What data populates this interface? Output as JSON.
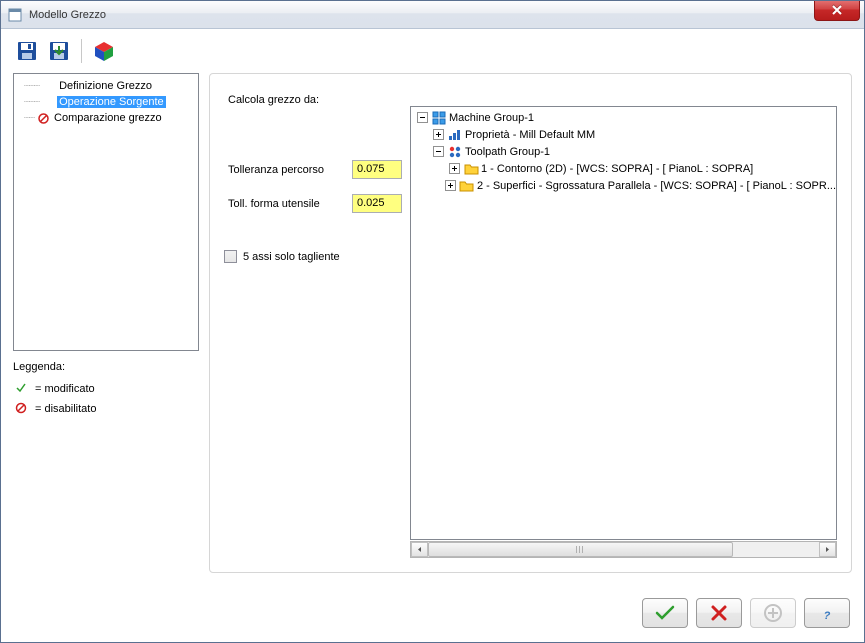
{
  "window": {
    "title": "Modello Grezzo"
  },
  "nav": {
    "items": [
      {
        "label": "Definizione Grezzo",
        "icon": "none",
        "selected": false
      },
      {
        "label": "Operazione Sorgente",
        "icon": "none",
        "selected": true
      },
      {
        "label": "Comparazione grezzo",
        "icon": "disabled",
        "selected": false
      }
    ]
  },
  "legend": {
    "title": "Leggenda:",
    "modified": "= modificato",
    "disabled": "= disabilitato"
  },
  "panel": {
    "calc_label": "Calcola grezzo da:",
    "tol_path_label": "Tolleranza percorso",
    "tol_path_value": "0.075",
    "tol_tool_label": "Toll. forma utensile",
    "tol_tool_value": "0.025",
    "five_axis_label": "5 assi solo tagliente"
  },
  "tree": {
    "root": {
      "label": "Machine Group-1"
    },
    "props": {
      "label": "Proprietà - Mill Default MM"
    },
    "tpg": {
      "label": "Toolpath Group-1"
    },
    "op1": {
      "label": "1 - Contorno  (2D) - [WCS: SOPRA] - [  PianoL  : SOPRA]"
    },
    "op2": {
      "label": "2 - Superfici - Sgrossatura Parallela - [WCS: SOPRA] - [  PianoL  : SOPR..."
    }
  }
}
